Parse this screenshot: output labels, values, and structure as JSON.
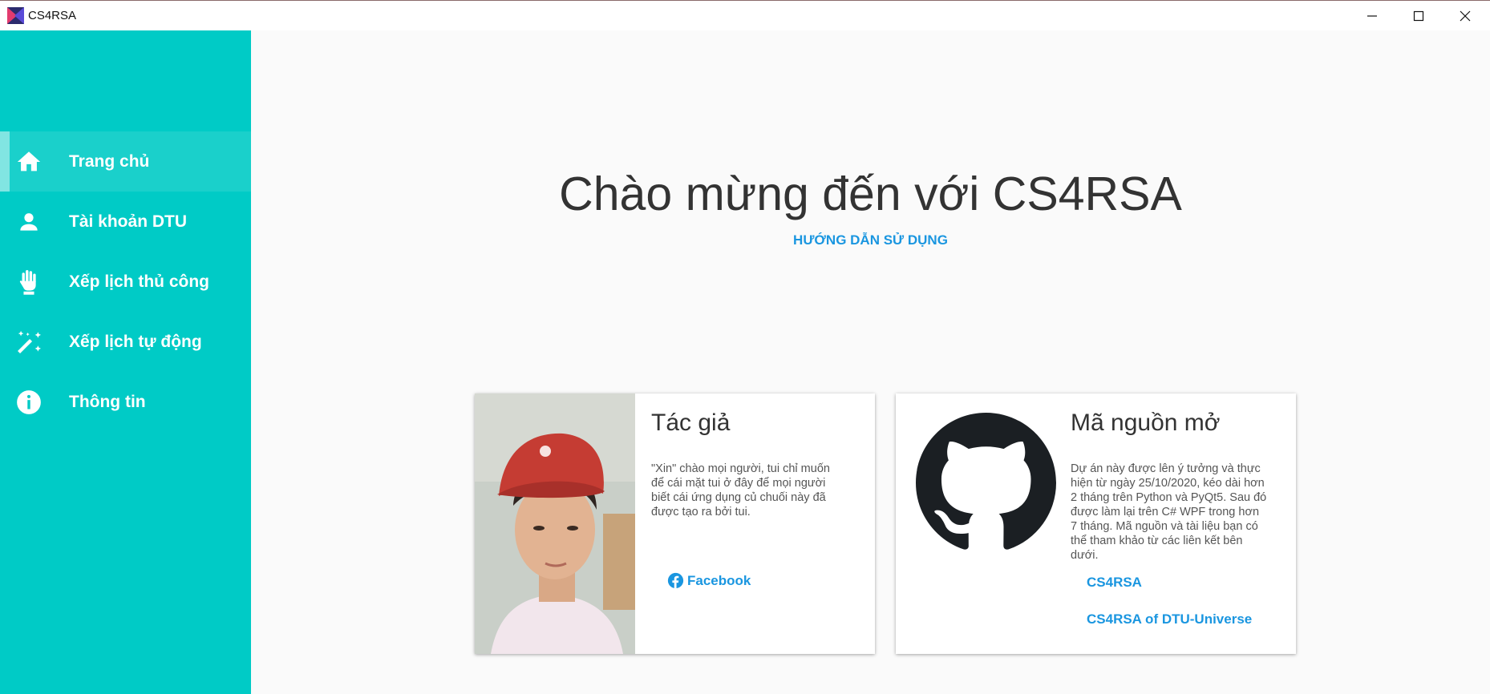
{
  "window": {
    "title": "CS4RSA",
    "controls": [
      "minimize-icon",
      "maximize-icon",
      "close-icon"
    ]
  },
  "sidebar": {
    "items": [
      {
        "label": "Trang chủ",
        "icon": "home-icon",
        "active": true
      },
      {
        "label": "Tài khoản DTU",
        "icon": "account-icon",
        "active": false
      },
      {
        "label": "Xếp lịch thủ công",
        "icon": "hand-icon",
        "active": false
      },
      {
        "label": "Xếp lịch tự động",
        "icon": "magic-wand-icon",
        "active": false
      },
      {
        "label": "Thông tin",
        "icon": "info-icon",
        "active": false
      }
    ]
  },
  "main": {
    "title": "Chào mừng đến với CS4RSA",
    "guide_link": "HƯỚNG DẪN SỬ DỤNG"
  },
  "author_card": {
    "title": "Tác giả",
    "text": "\"Xin\" chào mọi người, tui chỉ muốn để cái mặt tui ở đây để mọi người biết cái ứng dụng củ chuối này đã được tạo ra bởi tui.",
    "facebook_label": "Facebook"
  },
  "source_card": {
    "title": "Mã nguồn mở",
    "text": "Dự án này được lên ý tưởng và thực hiện từ ngày 25/10/2020, kéo dài hơn 2 tháng trên Python và PyQt5. Sau đó được làm lại trên C# WPF trong hơn 7 tháng. Mã nguồn và tài liệu bạn có thể tham khảo từ các liên kết bên dưới.",
    "links": [
      "CS4RSA",
      "CS4RSA of DTU-Universe"
    ]
  },
  "colors": {
    "sidebar": "#00cbc6",
    "accent": "#1a96e0",
    "background": "#fafafa"
  }
}
